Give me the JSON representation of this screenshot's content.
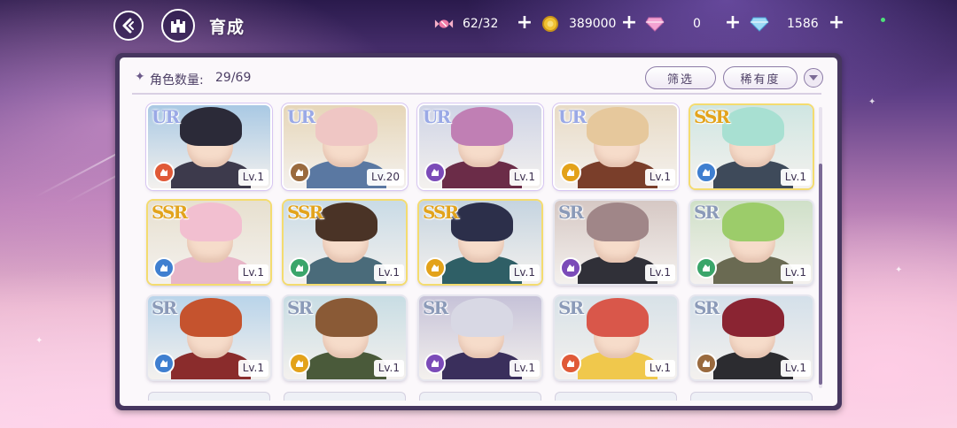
{
  "header": {
    "title": "育成",
    "back_icon": "back-arrow-icon",
    "home_icon": "castle-icon"
  },
  "resources": [
    {
      "icon": "candy-icon",
      "value": "62/32"
    },
    {
      "icon": "gold-coin-icon",
      "value": "389000"
    },
    {
      "icon": "pink-diamond-icon",
      "value": "0"
    },
    {
      "icon": "blue-diamond-icon",
      "value": "1586"
    }
  ],
  "panel": {
    "count_label": "角色数量:",
    "count_value": "29/69",
    "filter_label": "筛选",
    "rarity_sort_label": "稀有度"
  },
  "colors": {
    "panel_frame": "#46365f",
    "accent_text": "#4e4066",
    "ur_text": "#9aa9e6",
    "ssr_text": "#e2a31c",
    "sr_text": "#8b9ab8"
  },
  "characters": [
    {
      "rarity": "UR",
      "level": "Lv.1",
      "element": "red",
      "bg": "#a9c9e4",
      "hair": "#2b2a38",
      "outfit": "#3d3a4c"
    },
    {
      "rarity": "UR",
      "level": "Lv.20",
      "element": "brown",
      "bg": "#e6d6b8",
      "hair": "#efc6c4",
      "outfit": "#5a78a2"
    },
    {
      "rarity": "UR",
      "level": "Lv.1",
      "element": "purple",
      "bg": "#cfd4e6",
      "hair": "#c07fb4",
      "outfit": "#6b2c48"
    },
    {
      "rarity": "UR",
      "level": "Lv.1",
      "element": "yellow",
      "bg": "#e8dbc6",
      "hair": "#e6c89c",
      "outfit": "#7a3e2a"
    },
    {
      "rarity": "SSR",
      "level": "Lv.1",
      "element": "blue",
      "bg": "#cfe6e2",
      "hair": "#a8e0d2",
      "outfit": "#3e4a5a"
    },
    {
      "rarity": "SSR",
      "level": "Lv.1",
      "element": "blue",
      "bg": "#e7e0cf",
      "hair": "#f2bfd0",
      "outfit": "#e8b6c8"
    },
    {
      "rarity": "SSR",
      "level": "Lv.1",
      "element": "green",
      "bg": "#c9dbe6",
      "hair": "#4a3326",
      "outfit": "#4a6b7a"
    },
    {
      "rarity": "SSR",
      "level": "Lv.1",
      "element": "yellow",
      "bg": "#c5d4e0",
      "hair": "#2c2f4a",
      "outfit": "#2f5f66"
    },
    {
      "rarity": "SR",
      "level": "Lv.1",
      "element": "purple",
      "bg": "#d6c8c4",
      "hair": "#a08688",
      "outfit": "#303038"
    },
    {
      "rarity": "SR",
      "level": "Lv.1",
      "element": "green",
      "bg": "#cfe0c8",
      "hair": "#9ccc6a",
      "outfit": "#6a6a52"
    },
    {
      "rarity": "SR",
      "level": "Lv.1",
      "element": "blue",
      "bg": "#b9d4ea",
      "hair": "#c5532e",
      "outfit": "#8a2c2c"
    },
    {
      "rarity": "SR",
      "level": "Lv.1",
      "element": "yellow",
      "bg": "#c8dde4",
      "hair": "#8a5a36",
      "outfit": "#4a5a3a"
    },
    {
      "rarity": "SR",
      "level": "Lv.1",
      "element": "purple",
      "bg": "#c6c2d8",
      "hair": "#d8d8e4",
      "outfit": "#3a2f5c"
    },
    {
      "rarity": "SR",
      "level": "Lv.1",
      "element": "red",
      "bg": "#d8e2e8",
      "hair": "#d9574a",
      "outfit": "#f0c84c"
    },
    {
      "rarity": "SR",
      "level": "Lv.1",
      "element": "brown",
      "bg": "#d4e0ea",
      "hair": "#8a2432",
      "outfit": "#2c2c30"
    }
  ]
}
